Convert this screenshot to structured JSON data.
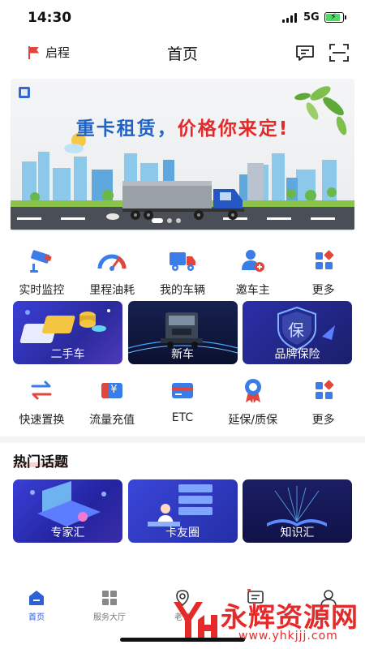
{
  "status": {
    "time": "14:30",
    "network": "5G"
  },
  "header": {
    "location": "启程",
    "title": "首页"
  },
  "banner": {
    "headline_left": "重卡租赁，",
    "headline_right": "价格你来定!"
  },
  "quick_row_1": [
    {
      "label": "实时监控",
      "icon": "camera-icon"
    },
    {
      "label": "里程油耗",
      "icon": "gauge-icon"
    },
    {
      "label": "我的车辆",
      "icon": "truck-icon"
    },
    {
      "label": "邀车主",
      "icon": "invite-user-icon"
    },
    {
      "label": "更多",
      "icon": "grid-icon"
    }
  ],
  "cards_1": [
    {
      "label": "二手车",
      "icon": "coins-icon"
    },
    {
      "label": "新车",
      "icon": "new-truck-icon"
    },
    {
      "label": "品牌保险",
      "icon": "shield-icon",
      "badge": "保"
    }
  ],
  "quick_row_2": [
    {
      "label": "快速置换",
      "icon": "swap-icon"
    },
    {
      "label": "流量充值",
      "icon": "recharge-icon",
      "symbol": "¥"
    },
    {
      "label": "ETC",
      "icon": "card-icon"
    },
    {
      "label": "延保/质保",
      "icon": "ribbon-icon"
    },
    {
      "label": "更多",
      "icon": "grid-icon"
    }
  ],
  "topics": {
    "title": "热门话题"
  },
  "cards_2": [
    {
      "label": "专家汇",
      "icon": "laptop-icon"
    },
    {
      "label": "卡友圈",
      "icon": "chat-people-icon"
    },
    {
      "label": "知识汇",
      "icon": "book-icon"
    }
  ],
  "tabs": [
    {
      "label": "首页",
      "icon": "home-icon",
      "active": true
    },
    {
      "label": "服务大厅",
      "icon": "grid-icon"
    },
    {
      "label": "老铁",
      "icon": "location-icon"
    },
    {
      "label": "",
      "icon": "message-icon"
    },
    {
      "label": "",
      "icon": "user-icon"
    }
  ],
  "watermark": {
    "text": "永辉资源网",
    "url": "www.yhkjjj.com"
  },
  "colors": {
    "accent": "#2f5fd9",
    "banner_blue": "#1f63c7",
    "banner_red": "#e12b2b",
    "card_dark": "#1a1f6b"
  }
}
